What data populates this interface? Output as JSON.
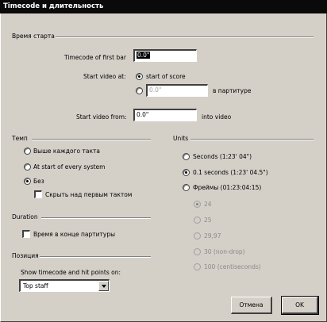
{
  "window": {
    "title": "Timecode и длительность"
  },
  "start_group": {
    "title": "Время старта",
    "timecode_label": "Timecode of first bar",
    "timecode_value": "0.0\"",
    "start_video_label": "Start video at:",
    "start_of_score_label": "start of score",
    "in_score_value": "0.0\"",
    "in_score_label": "в партитуре",
    "start_video_from_label": "Start video from:",
    "start_video_from_value": "0.0\"",
    "into_video_label": "into video"
  },
  "tempo_group": {
    "title": "Темп",
    "options": [
      "Выше каждого такта",
      "At start of every system",
      "Без"
    ],
    "selected": "Без",
    "hide_first_label": "Скрыть над первым тактом"
  },
  "duration_group": {
    "title": "Duration",
    "end_of_score_label": "Время в конце партитуры"
  },
  "position_group": {
    "title": "Позиция",
    "show_label": "Show timecode and hit points on:",
    "dropdown_value": "Top staff"
  },
  "units_group": {
    "title": "Units",
    "options": [
      "Seconds (1:23' 04\")",
      "0.1 seconds (1:23' 04.5\")",
      "Фреймы (01:23:04:15)"
    ],
    "selected": "0.1 seconds (1:23' 04.5\")",
    "frame_rates": [
      "24",
      "25",
      "29,97",
      "30 (non-drop)",
      "100 (centiseconds)"
    ],
    "frame_rate_selected": "24"
  },
  "buttons": {
    "cancel": "Отмена",
    "ok": "OK"
  }
}
